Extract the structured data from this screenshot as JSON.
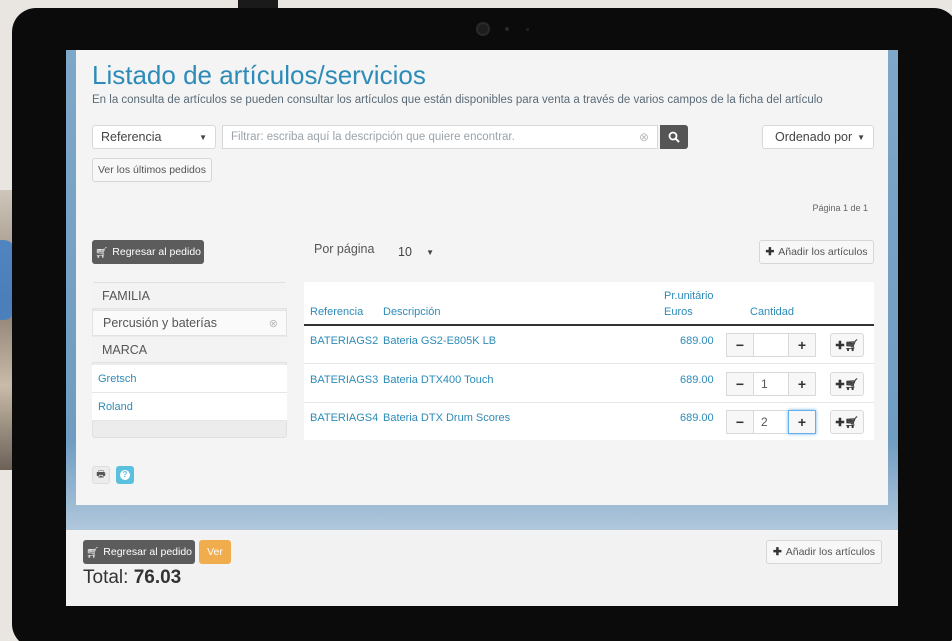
{
  "page": {
    "title": "Listado de artículos/servicios",
    "description": "En la consulta de artículos se pueden consultar los artículos que están disponibles para venta a través de varios campos de la ficha del artículo"
  },
  "search": {
    "field_select": "Referencia",
    "placeholder": "Filtrar: escriba aquí la descripción que quiere encontrar.",
    "order_select": "Ordenado por"
  },
  "toolbar": {
    "last_orders": "Ver los últimos pedidos",
    "page_info": "Página 1 de 1",
    "back_to_order": "Regresar al pedido",
    "per_page_label": "Por página",
    "per_page_value": "10",
    "add_items": "Añadir los artículos"
  },
  "sidebar": {
    "family_header": "FAMILIA",
    "family_selected": "Percusión y baterías",
    "brand_header": "MARCA",
    "brands": [
      "Gretsch",
      "Roland"
    ]
  },
  "table": {
    "headers": {
      "reference": "Referencia",
      "description": "Descripción",
      "unit_price_1": "Pr.unitário",
      "unit_price_2": "Euros",
      "quantity": "Cantidad"
    },
    "rows": [
      {
        "reference": "BATERIAGS2",
        "description": "Bateria GS2-E805K LB",
        "price": "689.00",
        "qty": ""
      },
      {
        "reference": "BATERIAGS3",
        "description": "Bateria DTX400 Touch",
        "price": "689.00",
        "qty": "1"
      },
      {
        "reference": "BATERIAGS4",
        "description": "Bateria DTX Drum Scores",
        "price": "689.00",
        "qty": "2"
      }
    ]
  },
  "footer": {
    "back_to_order": "Regresar al pedido",
    "view": "Ver",
    "add_items": "Añadir los artículos",
    "total_label": "Total:",
    "total_value": "76.03"
  },
  "icons": {
    "cart": "cart-icon",
    "search": "search-icon",
    "print": "print-icon",
    "help": "help-icon",
    "plus": "plus-icon",
    "add_to_cart": "add-to-cart-icon"
  },
  "colors": {
    "accent": "#2d8bb8",
    "dark_button": "#5c5c5c",
    "orange_button": "#f0ad4e",
    "help_button": "#5bc0de"
  }
}
